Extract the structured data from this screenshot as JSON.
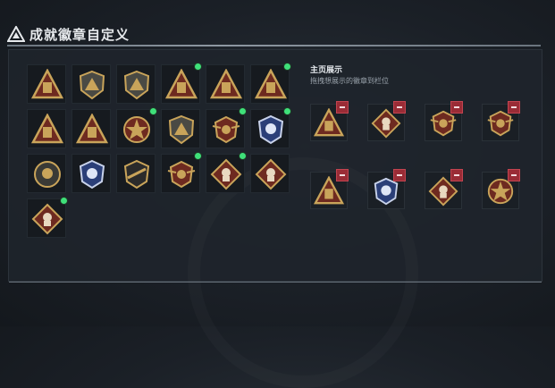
{
  "header": {
    "title": "成就徽章自定义"
  },
  "right_panel": {
    "title": "主页展示",
    "subtitle": "拖拽想展示的徽章到栏位"
  },
  "colors": {
    "gold": "#c9a45a",
    "dark_red": "#7a2a1e",
    "new_dot": "#3fe07a",
    "remove": "#9a2c36"
  },
  "badges": [
    {
      "icon": "shield-triangle-badge",
      "new": false
    },
    {
      "icon": "helicopter-badge",
      "new": false
    },
    {
      "icon": "jet-fighter-badge",
      "new": false
    },
    {
      "icon": "ammo-box-badge",
      "new": true
    },
    {
      "icon": "bullet-badge",
      "new": false
    },
    {
      "icon": "ammo-crate-badge",
      "new": true
    },
    {
      "icon": "triangle-gun-badge",
      "new": false
    },
    {
      "icon": "triangle-soldiers-badge",
      "new": false
    },
    {
      "icon": "star-crossed-guns-badge",
      "new": true
    },
    {
      "icon": "hexagon-crest-badge",
      "new": false
    },
    {
      "icon": "cross-shield-gold-badge",
      "new": true
    },
    {
      "icon": "crest-blue-badge",
      "new": true
    },
    {
      "icon": "skull-circle-badge",
      "new": false
    },
    {
      "icon": "blue-shield-rifle-badge",
      "new": false
    },
    {
      "icon": "rifle-shield-badge",
      "new": false
    },
    {
      "icon": "winged-crest-badge",
      "new": true
    },
    {
      "icon": "soldier-diamond-badge",
      "new": true
    },
    {
      "icon": "soldier-diamond-dark-badge",
      "new": false
    },
    {
      "icon": "soldier-running-badge",
      "new": true
    }
  ],
  "slots": [
    {
      "icon": "ammo-crate-badge"
    },
    {
      "icon": "soldier-diamond-badge"
    },
    {
      "icon": "winged-crest-badge"
    },
    {
      "icon": "cross-shield-gold-badge"
    },
    {
      "icon": "ammo-box-badge"
    },
    {
      "icon": "crest-blue-badge"
    },
    {
      "icon": "soldier-diamond-badge"
    },
    {
      "icon": "star-crossed-guns-badge"
    }
  ]
}
